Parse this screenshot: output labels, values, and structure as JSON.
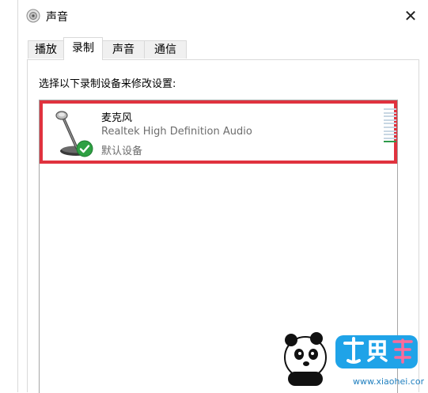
{
  "window": {
    "title": "声音",
    "close_symbol": "✕"
  },
  "tabs": [
    {
      "label": "播放",
      "active": false
    },
    {
      "label": "录制",
      "active": true
    },
    {
      "label": "声音",
      "active": false
    },
    {
      "label": "通信",
      "active": false
    }
  ],
  "recording": {
    "instruction": "选择以下录制设备来修改设置:",
    "devices": [
      {
        "name": "麦克风",
        "driver": "Realtek High Definition Audio",
        "status": "默认设备",
        "icon": "microphone-icon",
        "default_badge": "checkmark-icon",
        "level_fraction": 0.1
      }
    ]
  },
  "colors": {
    "highlight_border": "#e0323e",
    "level_active": "#2e9a4a",
    "level_idle": "#c8d7e3",
    "default_check": "#2ea043"
  },
  "watermark": {
    "url": "www.xiaohei.com",
    "logo_text": "小黑游戏"
  }
}
